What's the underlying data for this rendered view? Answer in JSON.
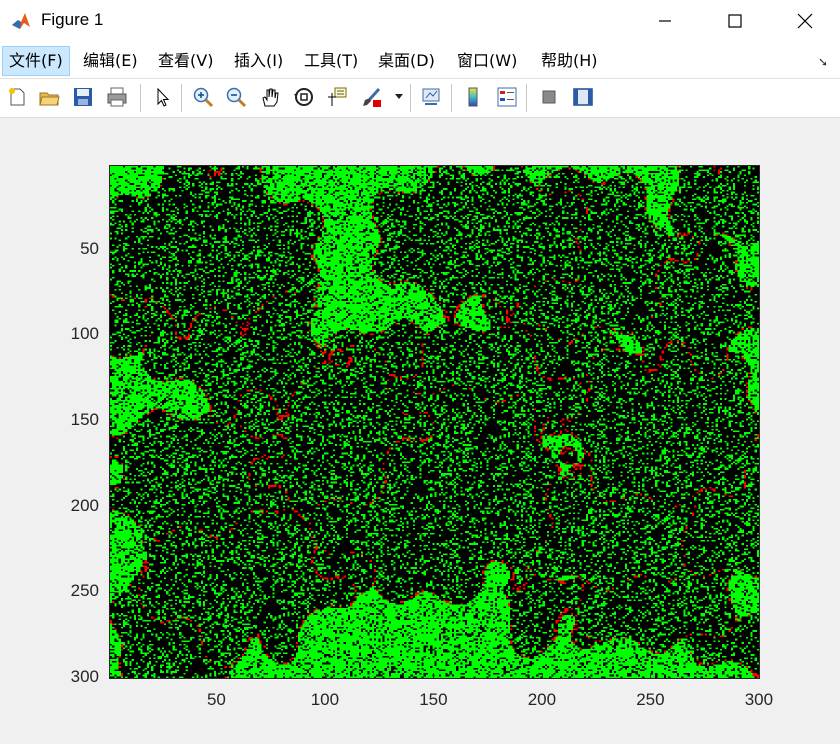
{
  "window": {
    "title": "Figure 1",
    "icon": "matlab-icon",
    "controls": [
      "minimize-icon",
      "maximize-icon",
      "close-icon"
    ]
  },
  "menu": {
    "items": [
      "文件(F)",
      "编辑(E)",
      "查看(V)",
      "插入(I)",
      "工具(T)",
      "桌面(D)",
      "窗口(W)",
      "帮助(H)"
    ],
    "active_index": 0,
    "overflow_icon": "dock-arrow-icon"
  },
  "toolbar": {
    "buttons": [
      "new-figure-icon",
      "open-file-icon",
      "save-icon",
      "print-icon",
      "edit-plot-arrow-icon",
      "zoom-in-icon",
      "zoom-out-icon",
      "pan-hand-icon",
      "rotate-3d-icon",
      "data-cursor-icon",
      "brush-icon",
      "brush-dropdown-icon",
      "link-plot-icon",
      "colorbar-icon",
      "legend-icon",
      "hide-plot-tools-icon",
      "show-plot-tools-icon"
    ]
  },
  "chart_data": {
    "type": "heatmap",
    "description_colors": [
      "#000000",
      "#00ff00",
      "#ff0000"
    ],
    "x_ticks": [
      50,
      100,
      150,
      200,
      250,
      300
    ],
    "y_ticks": [
      50,
      100,
      150,
      200,
      250,
      300
    ],
    "xlim": [
      0.5,
      300.5
    ],
    "ylim": [
      0.5,
      300.5
    ],
    "y_direction": "reverse",
    "size": [
      300,
      300
    ],
    "title": "",
    "xlabel": "",
    "ylabel": ""
  },
  "colors": {
    "background": "#f0f0f0",
    "menu_active_bg": "#cce8ff",
    "green": "#00ff00",
    "black": "#000000",
    "red": "#ff0000"
  }
}
